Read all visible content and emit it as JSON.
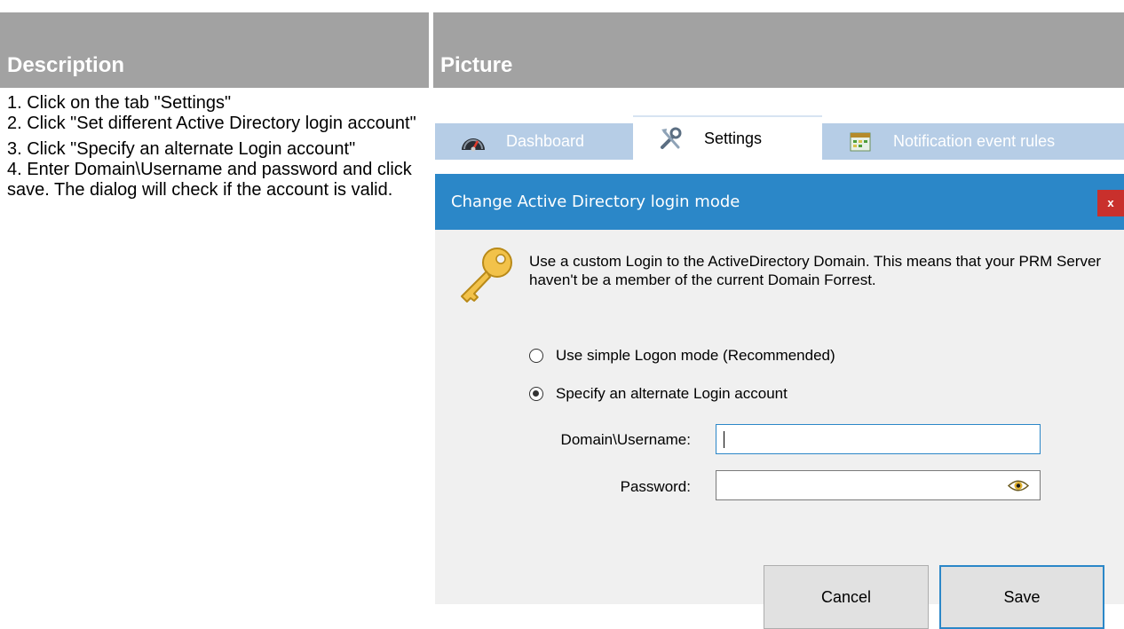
{
  "table": {
    "col_description": "Description",
    "col_picture": "Picture"
  },
  "steps": [
    "1. Click on the tab \"Settings\"",
    "2. Click \"Set different Active Directory login account\"",
    "3. Click \"Specify an alternate Login account\"",
    "4. Enter Domain\\Username and password and click save. The dialog will check if the account is valid."
  ],
  "tabs": [
    {
      "label": "Dashboard",
      "icon": "speedometer-icon",
      "active": false
    },
    {
      "label": "Settings",
      "icon": "tools-icon",
      "active": true
    },
    {
      "label": "Notification event rules",
      "icon": "calendar-icon",
      "active": false
    }
  ],
  "dialog": {
    "title": "Change Active Directory login mode",
    "close_label": "x",
    "description": "Use a custom Login to the ActiveDirectory Domain. This means that your PRM Server haven't be a member of the current Domain Forrest.",
    "options": [
      {
        "label": "Use simple Logon mode (Recommended)",
        "checked": false
      },
      {
        "label": "Specify an alternate Login account",
        "checked": true
      }
    ],
    "username_label": "Domain\\Username:",
    "username_value": "",
    "password_label": "Password:",
    "password_value": "",
    "cancel_label": "Cancel",
    "save_label": "Save",
    "accent_color": "#2b87c8",
    "close_color": "#c9302c"
  }
}
